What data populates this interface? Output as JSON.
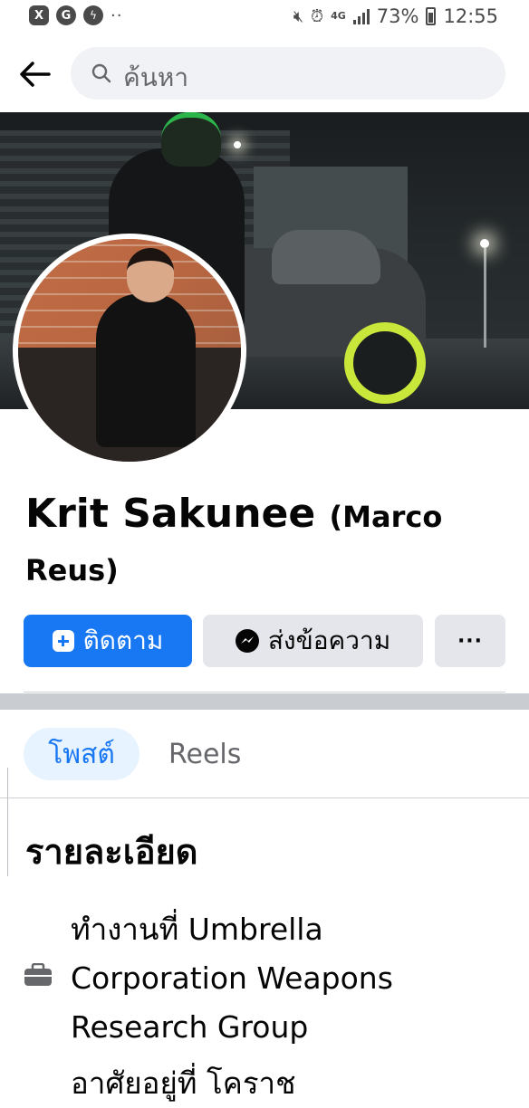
{
  "status_bar": {
    "left_apps": [
      "X",
      "G",
      "messenger"
    ],
    "more": "··",
    "network": "4G",
    "battery": "73%",
    "time": "12:55"
  },
  "header": {
    "search_placeholder": "ค้นหา"
  },
  "profile": {
    "name": "Krit Sakunee",
    "nickname": "(Marco Reus)"
  },
  "actions": {
    "follow_label": "ติดตาม",
    "message_label": "ส่งข้อความ",
    "more_label": "···"
  },
  "tabs": [
    {
      "label": "โพสต์",
      "active": true
    },
    {
      "label": "Reels",
      "active": false
    }
  ],
  "details": {
    "title": "รายละเอียด",
    "work": "ทำงานที่ Umbrella Corporation Weapons Research Group",
    "next_partial": "อาศัยอยู่ที่ โคราช"
  },
  "colors": {
    "primary": "#1877f2",
    "tab_active_bg": "#e7f3ff",
    "button_gray": "#e4e6eb"
  }
}
